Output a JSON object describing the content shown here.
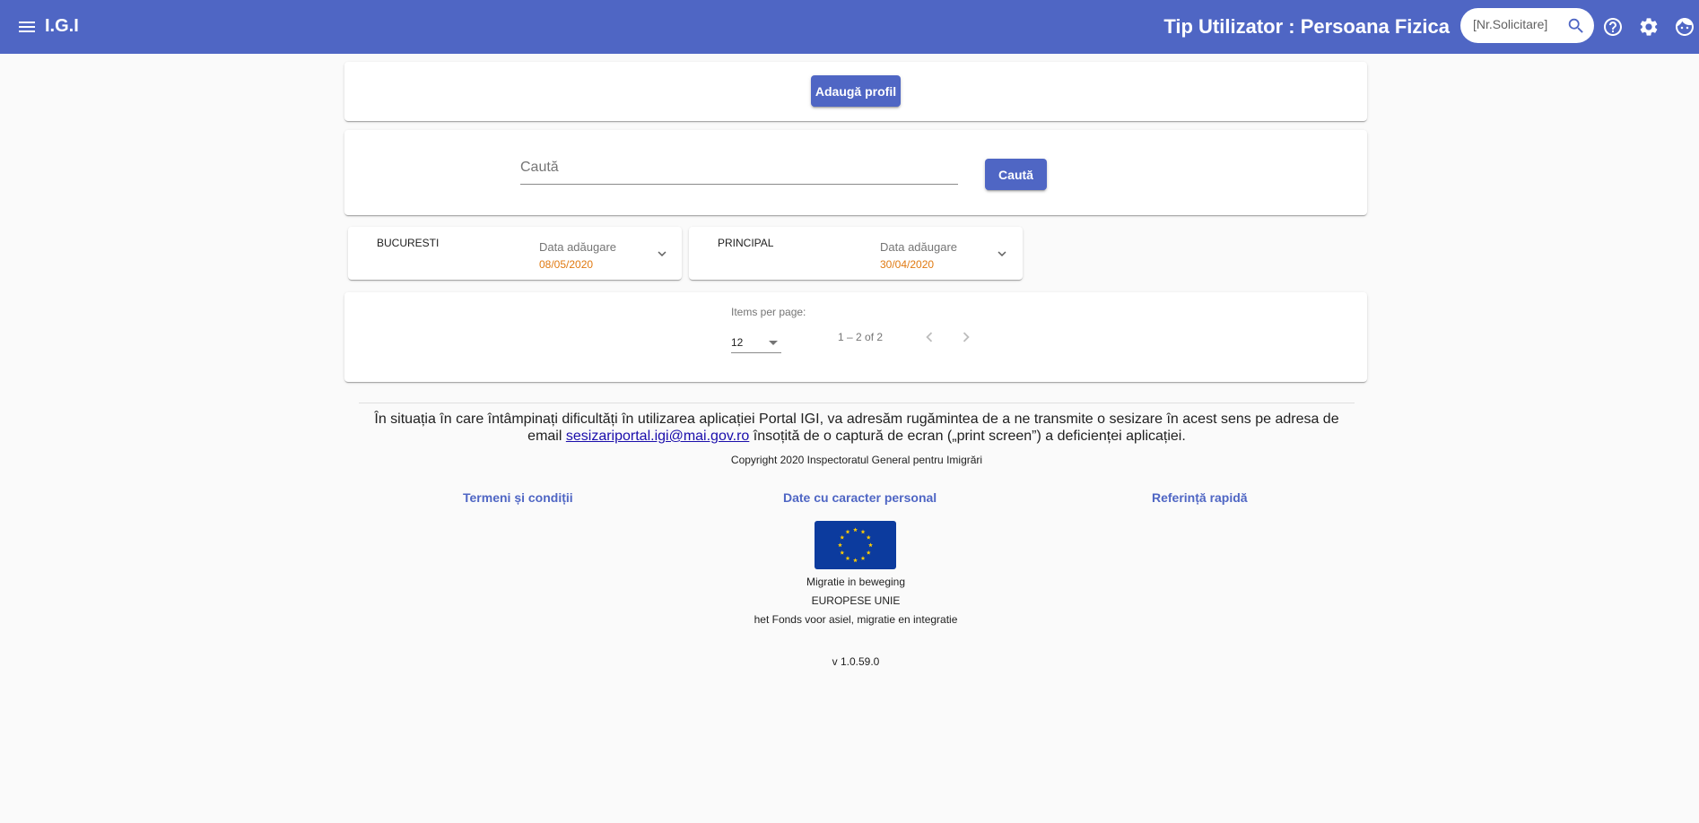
{
  "header": {
    "app_title": "I.G.I",
    "user_type": "Tip Utilizator : Persoana Fizica",
    "search_placeholder": "[Nr.Solicitare]",
    "icons": [
      "menu-icon",
      "search-icon",
      "help-icon",
      "gear-icon",
      "account-face-icon"
    ],
    "color": "#4f66c4"
  },
  "actions": {
    "add_profile_label": "Adaugă profil"
  },
  "search": {
    "placeholder": "Caută",
    "button_label": "Caută"
  },
  "profiles": [
    {
      "name": "BUCURESTI",
      "date_label": "Data adăugare",
      "date_value": "08/05/2020"
    },
    {
      "name": "PRINCIPAL",
      "date_label": "Data adăugare",
      "date_value": "30/04/2020"
    }
  ],
  "paginator": {
    "items_per_page_label": "Items per page:",
    "page_size": "12",
    "range_label": "1 – 2 of 2"
  },
  "footer": {
    "notice_before": "În situația în care întâmpinați dificultăți în utilizarea aplicației Portal IGI, va adresăm rugămintea de a ne transmite o sesizare în acest sens pe adresa de email ",
    "notice_email": "sesizariportal.igi@mai.gov.ro",
    "notice_after": " însoțită de o captură de ecran („print screen”) a deficienței aplicației.",
    "copyright": "Copyright 2020 Inspectoratul General pentru Imigrări",
    "links": {
      "terms": "Termeni și condiții",
      "personal_data": "Date cu caracter personal",
      "quick_reference": "Referință rapidă"
    },
    "eu_lines": [
      "Migratie in beweging",
      "EUROPESE UNIE",
      "het Fonds voor asiel, migratie en integratie"
    ],
    "version": "v 1.0.59.0"
  },
  "colors": {
    "primary": "#4f66c4",
    "date_accent": "#e07a12",
    "eu_blue": "#0c3b9e",
    "eu_star": "#ffcc00"
  }
}
